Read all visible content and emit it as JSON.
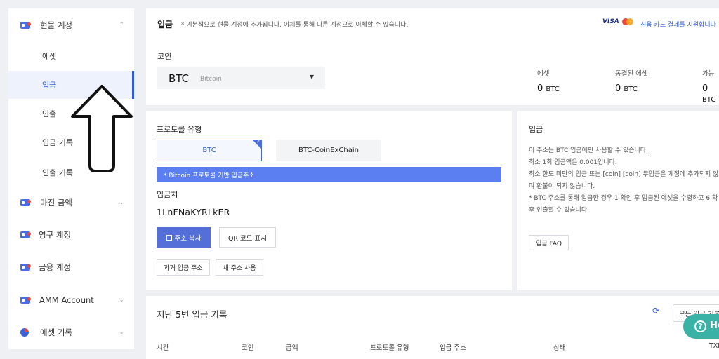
{
  "sidebar": {
    "items": [
      {
        "label": "현물 계정",
        "expanded": true,
        "icon": "wallet-icon"
      },
      {
        "label": "마진 금액",
        "icon": "margin-icon"
      },
      {
        "label": "영구 계정",
        "icon": "perpetual-icon"
      },
      {
        "label": "금융 계정",
        "icon": "finance-icon"
      },
      {
        "label": "AMM Account",
        "icon": "amm-icon"
      },
      {
        "label": "에셋 기록",
        "icon": "asset-history-icon"
      }
    ],
    "sub_items": [
      "에셋",
      "입금",
      "인출",
      "입금 기록",
      "인출 기록"
    ],
    "active_sub": "입금"
  },
  "header": {
    "title": "입금",
    "note": "* 기본적으로 현물 계정에 추가됩니다. 이체를 통해 다른 계정으로 이체할 수 있습니다.",
    "card_brand_visa": "VISA",
    "card_text": "신용 카드 결제를 지원합니다"
  },
  "coin": {
    "label": "코인",
    "symbol": "BTC",
    "name": "Bitcoin"
  },
  "balances": [
    {
      "label": "에셋",
      "value": "0",
      "unit": "BTC"
    },
    {
      "label": "동결된 에셋",
      "value": "0",
      "unit": "BTC"
    },
    {
      "label": "가능",
      "value": "0",
      "unit": "BTC"
    }
  ],
  "protocol": {
    "title": "프로토콜 유형",
    "options": [
      "BTC",
      "BTC-CoinExChain"
    ],
    "selected": "BTC",
    "info": "* Bitcoin 프로토콜 기반 입금주소",
    "address_label": "입금처",
    "address": "1LnFNaKYRLkER",
    "copy_label": "주소 복사",
    "qr_label": "QR 코드 표시",
    "past_label": "과거 입금 주소",
    "new_label": "새 주소 사용"
  },
  "info": {
    "title": "입금",
    "lines": [
      "이 주소는 BTC 입금에만 사용할 수 있습니다.",
      "최소 1회 입금액은 0.001입니다.",
      "최소 한도 미만의 입금 또는 [coin] [coin] 무입금은 계정에 추가되지 않으",
      "며 환불이 되지 않습니다.",
      "* BTC 주소를 통해 입금한 경우 1 확인 후 입금된 에셋을 수령하고 6 확",
      "후 인출할 수 있습니다."
    ],
    "faq_label": "입금 FAQ"
  },
  "history": {
    "title": "지난 5번 입금 기록",
    "all_label": "모든 입금 기록",
    "columns": [
      "시간",
      "코인",
      "금액",
      "프로토콜 유형",
      "입금 주소",
      "상태",
      "TXID"
    ]
  },
  "help": {
    "label": "Help"
  }
}
